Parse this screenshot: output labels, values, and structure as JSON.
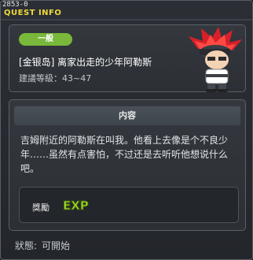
{
  "window": {
    "id_label": "2853-0",
    "title": "QUEST INFO"
  },
  "quest": {
    "category_badge": "一般",
    "name": "[金银岛] 离家出走的少年阿勒斯",
    "level_label": "建議等級：43~47"
  },
  "content": {
    "section_title": "内容",
    "description": "吉姆附近的阿勒斯在叫我。他看上去像是个不良少年……虽然有点害怕，不过还是去听听他想说什么吧。"
  },
  "reward": {
    "label": "獎勵",
    "icon": "exp-icon",
    "icon_text": "EXP"
  },
  "status": {
    "label": "狀態:",
    "value": "可開始"
  },
  "colors": {
    "title": "#f0d93a",
    "badge": "#79b83a",
    "exp_green": "#a6e02a"
  }
}
